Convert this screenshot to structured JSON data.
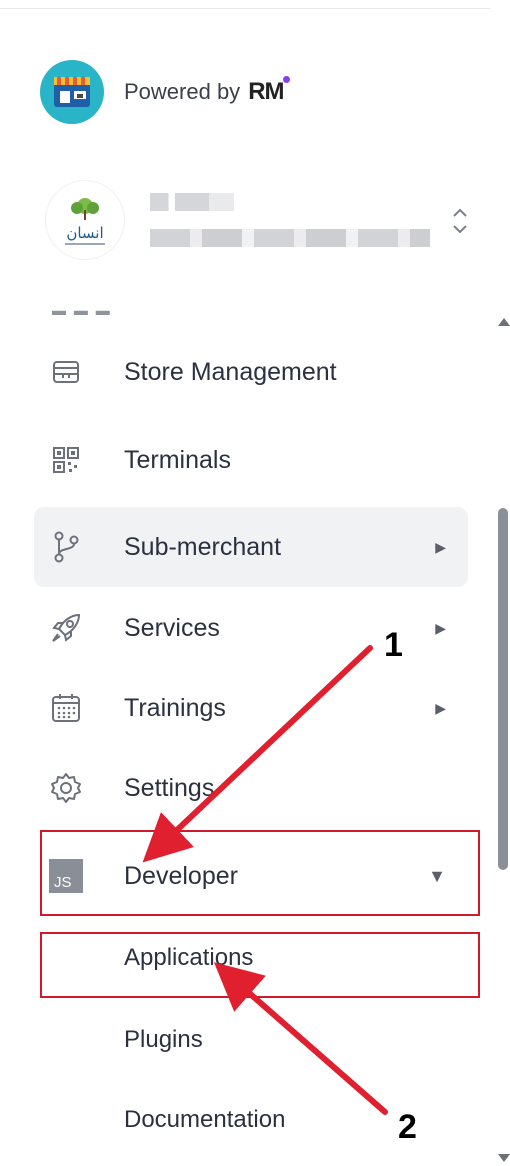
{
  "header": {
    "powered_label": "Powered by",
    "brand_mark": "RM",
    "brand_color": "#29b4c8"
  },
  "merchant": {
    "logo_text": "انسان",
    "switcher_icon": "chevron-updown-icon"
  },
  "menu": {
    "items": [
      {
        "label": "Store Management",
        "icon": "store-icon",
        "has_submenu": false
      },
      {
        "label": "Terminals",
        "icon": "qr-code-icon",
        "has_submenu": false
      },
      {
        "label": "Sub-merchant",
        "icon": "branch-icon",
        "has_submenu": true,
        "caret": "▶",
        "active": true
      },
      {
        "label": "Services",
        "icon": "rocket-icon",
        "has_submenu": true,
        "caret": "▶"
      },
      {
        "label": "Trainings",
        "icon": "calendar-icon",
        "has_submenu": true,
        "caret": "▶"
      },
      {
        "label": "Settings",
        "icon": "gear-icon",
        "has_submenu": false
      },
      {
        "label": "Developer",
        "icon": "js-icon",
        "icon_text": "JS",
        "has_submenu": true,
        "caret": "▼",
        "expanded": true
      }
    ],
    "developer_subitems": [
      {
        "label": "Applications"
      },
      {
        "label": "Plugins"
      },
      {
        "label": "Documentation"
      }
    ]
  },
  "annotations": {
    "step1": "1",
    "step2": "2",
    "color": "#e0202e"
  }
}
